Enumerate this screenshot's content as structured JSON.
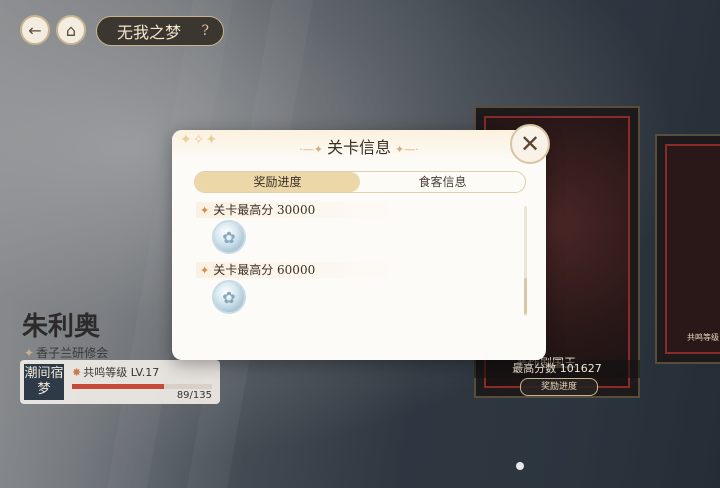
{
  "header": {
    "back_icon": "back-arrow-icon",
    "home_icon": "home-icon",
    "title": "无我之梦",
    "help_label": "?"
  },
  "character": {
    "name": "朱利奥",
    "organization": "香子兰研修会",
    "badge": "潮间宿梦",
    "level_label": "共鸣等级 LV.17",
    "exp_text": "89/135",
    "exp_fraction": 0.659
  },
  "card": {
    "name": "恶作剧国王",
    "score_text": "最高分数 101627",
    "button_label": "奖励进度",
    "side_text": "共鸣等级"
  },
  "modal": {
    "title": "关卡信息",
    "tabs": [
      {
        "label": "奖励进度",
        "active": true
      },
      {
        "label": "食客信息",
        "active": false
      }
    ],
    "rewards": [
      {
        "label": "关卡最高分  30000",
        "icon": "crystal-icon"
      },
      {
        "label": "关卡最高分  60000",
        "icon": "crystal-icon"
      }
    ]
  },
  "colors": {
    "accent": "#ecd7a8",
    "bar_fill": "#c64a3a",
    "card_red": "#8a2a2a"
  }
}
